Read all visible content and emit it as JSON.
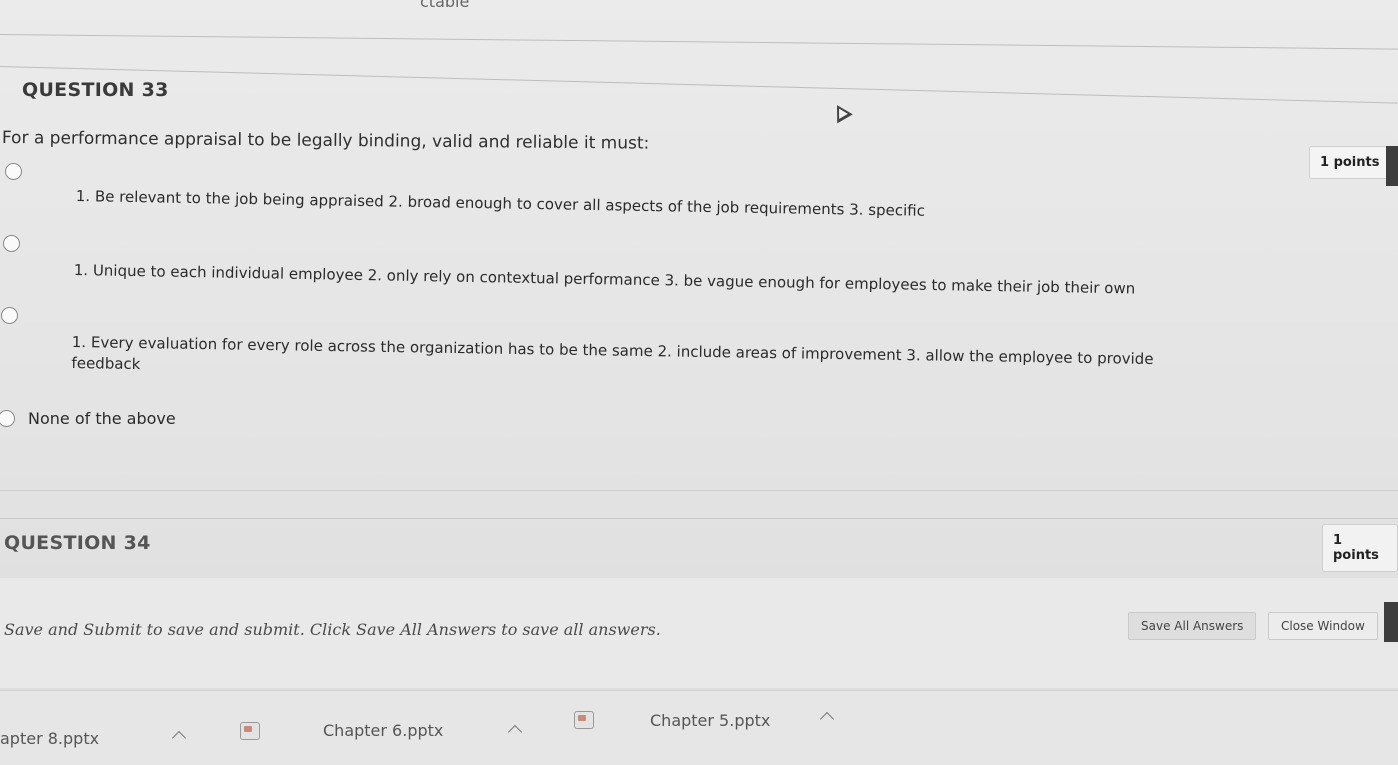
{
  "top_cut_text": "ctable",
  "question33": {
    "header": "QUESTION 33",
    "text": "For a performance appraisal to be legally binding, valid and reliable it must:",
    "points": "1 points",
    "options": [
      {
        "label": "1. Be relevant to the job being appraised 2. broad enough to cover all aspects of the job requirements 3. specific"
      },
      {
        "label": "1. Unique to each individual employee 2. only rely on contextual performance 3. be vague enough for employees to make their job their own"
      },
      {
        "label": "1. Every evaluation for every role across the organization has to be the same 2. include areas of improvement 3. allow the employee to provide feedback"
      },
      {
        "label": "None of the above"
      }
    ]
  },
  "question34": {
    "header": "QUESTION 34",
    "points": "1 points"
  },
  "footer": {
    "message": "Save and Submit to save and submit. Click Save All Answers to save all answers.",
    "save_all_label": "Save All Answers",
    "close_label": "Close Window"
  },
  "downloads": [
    {
      "name": "apter 8.pptx"
    },
    {
      "name": "Chapter 6.pptx"
    },
    {
      "name": "Chapter 5.pptx"
    }
  ]
}
